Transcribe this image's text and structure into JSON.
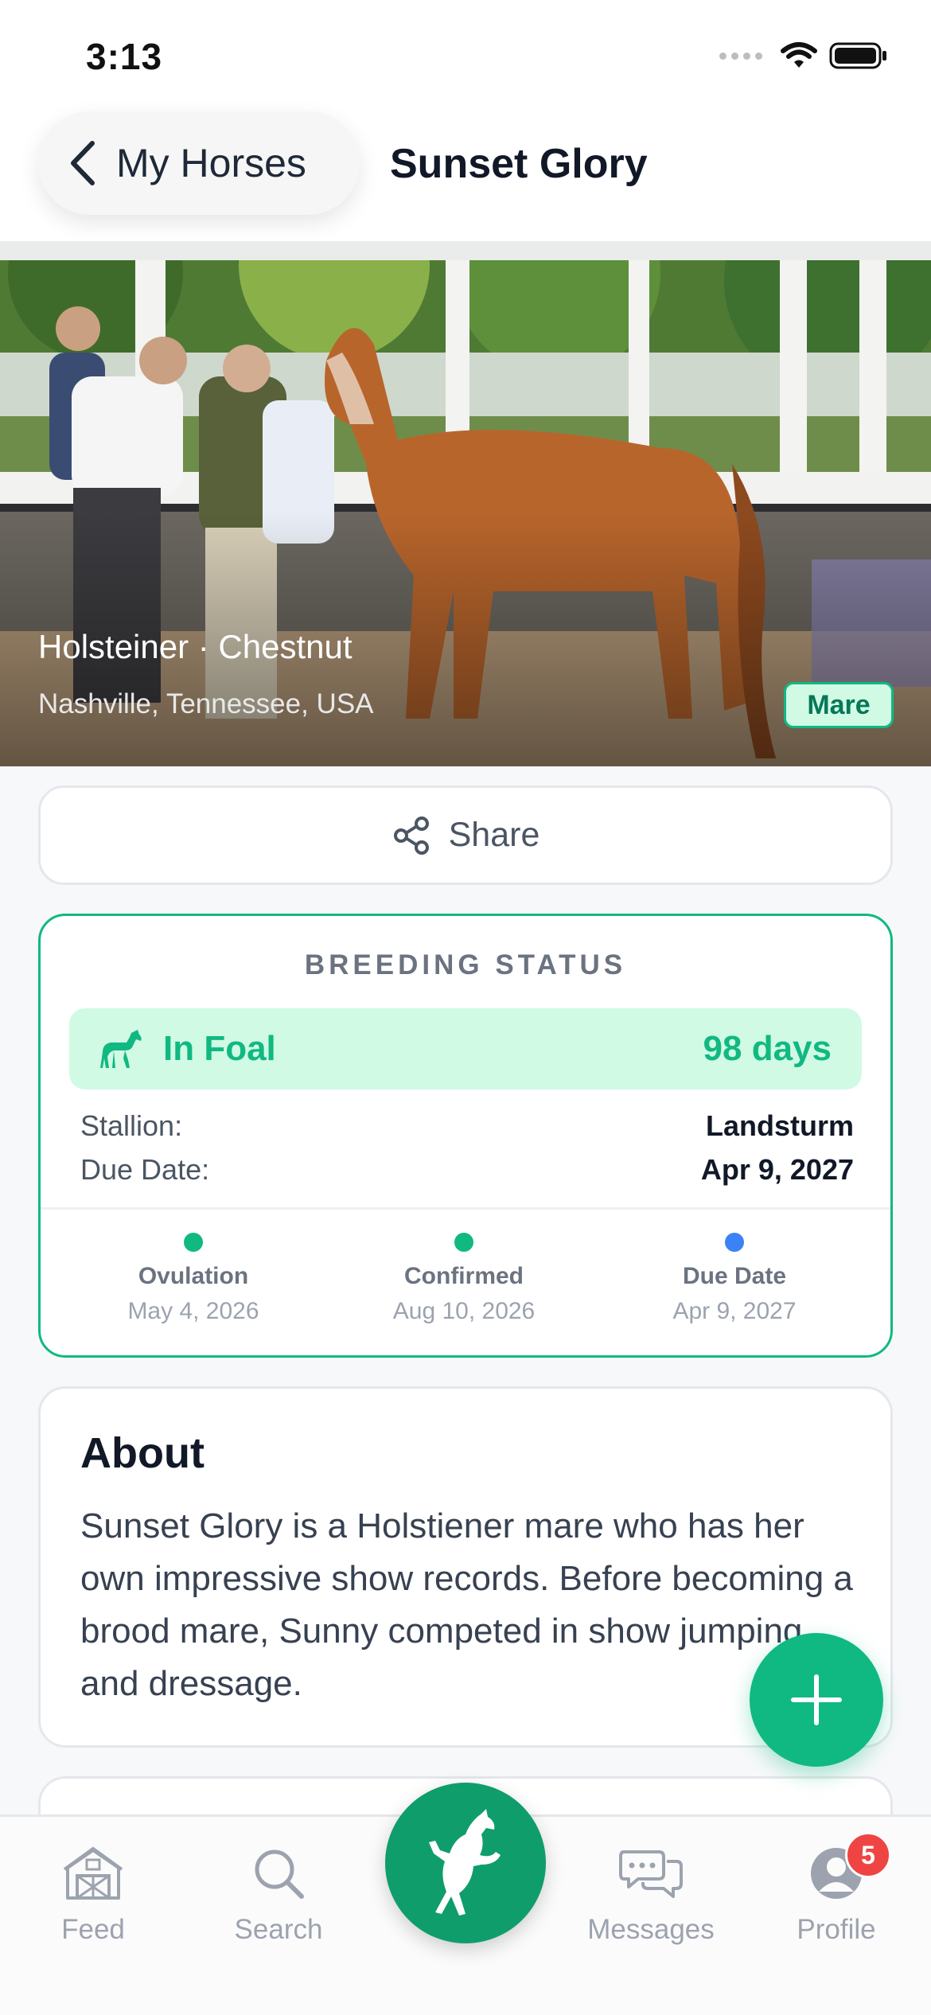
{
  "status_bar": {
    "time": "3:13"
  },
  "header": {
    "back_label": "My Horses",
    "title": "Sunset Glory"
  },
  "hero": {
    "breed_color": "Holsteiner · Chestnut",
    "location": "Nashville, Tennessee, USA",
    "gender": "Mare"
  },
  "share": {
    "label": "Share"
  },
  "breeding": {
    "title": "BREEDING STATUS",
    "status": "In Foal",
    "days": "98 days",
    "stallion_label": "Stallion:",
    "stallion_value": "Landsturm",
    "due_label": "Due Date:",
    "due_value": "Apr 9, 2027",
    "timeline": [
      {
        "label": "Ovulation",
        "date": "May 4, 2026",
        "color": "#10b981"
      },
      {
        "label": "Confirmed",
        "date": "Aug 10, 2026",
        "color": "#10b981"
      },
      {
        "label": "Due Date",
        "date": "Apr 9, 2027",
        "color": "#3b82f6"
      }
    ]
  },
  "about": {
    "title": "About",
    "text": "Sunset Glory is a Holstiener mare who has her own impressive show records. Before becoming a brood mare, Sunny competed in show jumping and dressage."
  },
  "tabs": [
    {
      "label": "Feed",
      "icon": "barn-icon"
    },
    {
      "label": "Search",
      "icon": "search-icon"
    },
    {
      "label": "",
      "icon": "horse-rearing-icon"
    },
    {
      "label": "Messages",
      "icon": "chat-bubbles-icon"
    },
    {
      "label": "Profile",
      "icon": "user-icon",
      "badge": "5"
    }
  ],
  "colors": {
    "accent": "#10b981",
    "accent_dark": "#0f9d6c",
    "badge": "#ef4444",
    "timeline_due": "#3b82f6"
  }
}
